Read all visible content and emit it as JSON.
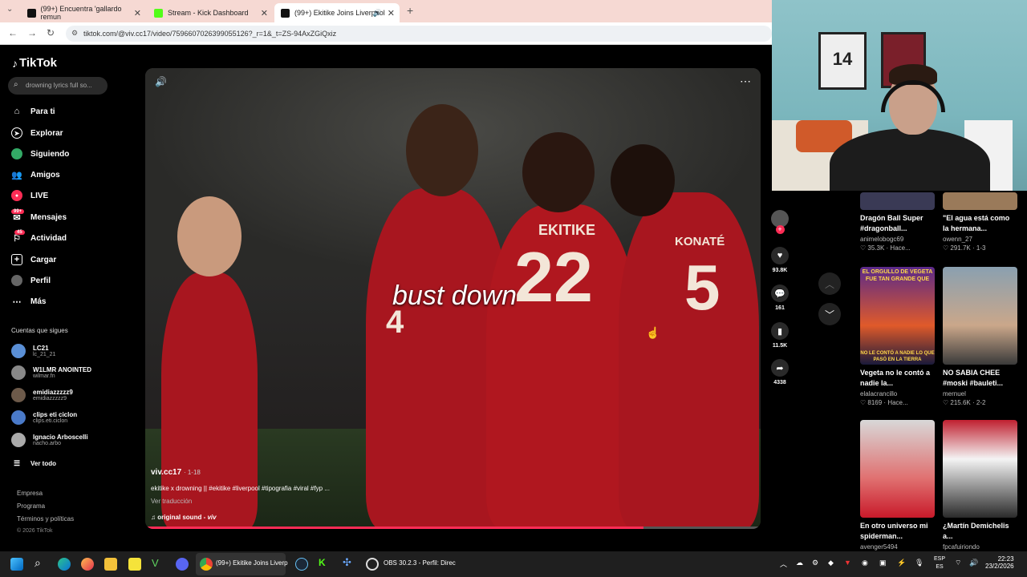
{
  "browser": {
    "tabs": [
      {
        "label": "(99+) Encuentra 'gallardo remun"
      },
      {
        "label": "Stream - Kick Dashboard"
      },
      {
        "label": "(99+) Ekitike Joins Liverpool"
      }
    ],
    "url": "tiktok.com/@viv.cc17/video/7596607026399055126?_r=1&_t=ZS-94AxZGiQxiz"
  },
  "sidebar": {
    "logo": "TikTok",
    "search_placeholder": "drowning lyrics full so...",
    "nav": [
      {
        "label": "Para ti"
      },
      {
        "label": "Explorar"
      },
      {
        "label": "Siguiendo"
      },
      {
        "label": "Amigos"
      },
      {
        "label": "LIVE"
      },
      {
        "label": "Mensajes",
        "badge": "99+"
      },
      {
        "label": "Actividad",
        "badge": "45"
      },
      {
        "label": "Cargar"
      },
      {
        "label": "Perfil"
      },
      {
        "label": "Más"
      }
    ],
    "following_title": "Cuentas que sigues",
    "following": [
      {
        "name": "LC21",
        "handle": "lc_21_21"
      },
      {
        "name": "W1LMR ANOINTED",
        "handle": "wilmar.fn"
      },
      {
        "name": "emidiazzzzz9",
        "handle": "emidiazzzzz9"
      },
      {
        "name": "clips eti ciclon",
        "handle": "clips.eti.ciclon"
      },
      {
        "name": "Ignacio Arboscelli",
        "handle": "nacho.arbo"
      }
    ],
    "see_all": "Ver todo",
    "footer": [
      "Empresa",
      "Programa",
      "Términos y políticas",
      "© 2026 TikTok"
    ]
  },
  "video": {
    "caption": "bust down",
    "user": "viv.cc17",
    "date": "· 1-18",
    "description": "ekitike x drowning || #ekitike #liverpool #tipografia #viral #fyp ...",
    "translate": "Ver traducción",
    "sound": "original sound - ",
    "sound_author": "viv",
    "jersey_names": [
      "EKITIKE",
      "KONATÉ"
    ],
    "jersey_numbers": [
      "22",
      "5",
      "4"
    ],
    "progress": 0.81
  },
  "actions": [
    {
      "icon": "heart-icon",
      "value": "93.8K"
    },
    {
      "icon": "comment-icon",
      "value": "161"
    },
    {
      "icon": "bookmark-icon",
      "value": "11.5K"
    },
    {
      "icon": "share-icon",
      "value": "4338"
    }
  ],
  "recommended": [
    {
      "title": "Dragón Ball Super #dragonball...",
      "user": "animelobogc69",
      "stats": "35.3K · Hace..."
    },
    {
      "title": "\"El agua está como la hermana...",
      "user": "owenn_27",
      "stats": "291.7K · 1-3"
    },
    {
      "title": "Vegeta no le contó a nadie la...",
      "user": "elalacrancillo",
      "stats": "8169 · Hace...",
      "overlay_top": "EL ORGULLO DE VEGETA FUE TAN GRANDE QUE",
      "overlay_bottom": "NO LE CONTÓ A NADIE LO QUE PASÓ EN LA TIERRA"
    },
    {
      "title": "NO SABIA CHEE #moski #bauleti...",
      "user": "mernuel",
      "stats": "215.6K · 2-2"
    },
    {
      "title": "En otro universo mi spiderman...",
      "user": "avenger5494",
      "stats": ""
    },
    {
      "title": "¿Martín Demichelis a...",
      "user": "fpcafuiriondo",
      "stats": ""
    }
  ],
  "taskbar": {
    "chrome_label": "(99+) Ekitike Joins Liverp",
    "obs_label": "OBS 30.2.3 - Perfil: Direc",
    "lang": "ESP",
    "lang2": "ES",
    "time": "22:23",
    "date": "23/2/2026"
  },
  "colors": {
    "accent": "#fe2c55",
    "jersey": "#a8161f"
  }
}
